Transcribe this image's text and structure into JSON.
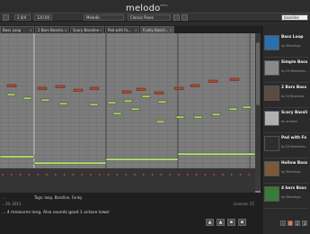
{
  "header": {
    "logo_text": "melodo",
    "logo_sup": "BETA",
    "tempo_box": "2.4/4",
    "bpm_box": "120.00",
    "mode_select": "Melodic",
    "instrument_select": "Classic Piano",
    "search_value": "baseline"
  },
  "tabs": [
    {
      "label": "Bass Loop"
    },
    {
      "label": "2 Bars Basslin..."
    },
    {
      "label": "Scary Bassline"
    },
    {
      "label": "Pad with Fa..."
    },
    {
      "label": "Funky Bassli..."
    }
  ],
  "info": {
    "left_small": "...",
    "tags_label": "Tags: loop, Bassline, Funky",
    "date_text": "...19, 2011",
    "description": "... 4 measures long. Also sounds good 1 octave lower",
    "license_text": "License: CC"
  },
  "sidebar": {
    "items": [
      {
        "title": "Bass Loop",
        "by": "by Melonliga",
        "color": "#2a6fb0"
      },
      {
        "title": "Simple Bass",
        "by": "by DJ Memedes...",
        "color": "#8a8a8a"
      },
      {
        "title": "2 Bars Bass",
        "by": "by DJ Bassloop",
        "color": "#5a4a40"
      },
      {
        "title": "Scary Bassli",
        "by": "by andrew",
        "color": "#b0b0b0"
      },
      {
        "title": "Pad with Fa",
        "by": "by DJ Memedes...",
        "color": "#2e2e2e"
      },
      {
        "title": "Hollow Bass",
        "by": "by Melonliga",
        "color": "#7a5a3a"
      },
      {
        "title": "4 bars Bass",
        "by": "by Melonliga",
        "color": "#3a7a3a"
      }
    ],
    "pages": [
      "1",
      "2",
      "3"
    ]
  },
  "colors": {
    "accent": "#e06a2b",
    "note_red": "#b6482c",
    "note_green": "#a8d06a",
    "note_bass": "#b7e27a"
  }
}
